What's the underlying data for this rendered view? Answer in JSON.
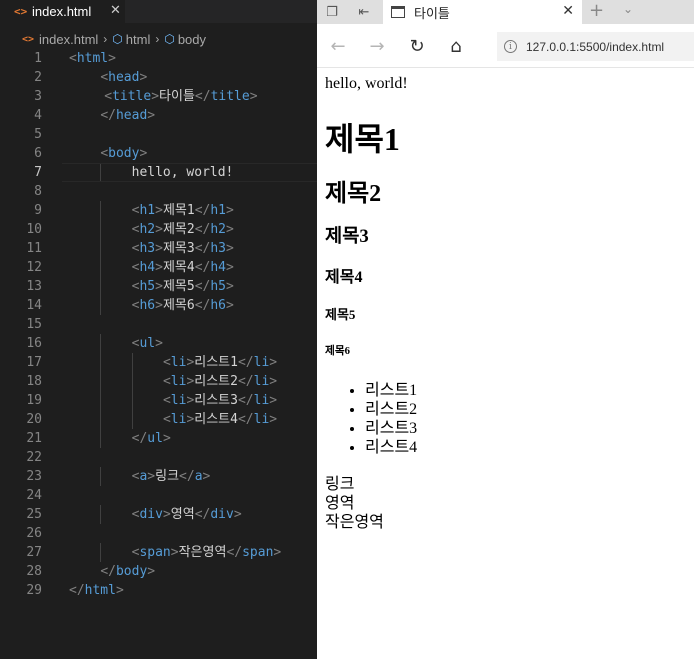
{
  "editor": {
    "tab": {
      "icon": "html-file-icon",
      "title": "index.html",
      "close_glyph": "✕"
    },
    "breadcrumb": [
      "index.html",
      "html",
      "body"
    ],
    "current_line": 7,
    "lines": [
      {
        "n": "1",
        "indent": 0,
        "parts": [
          [
            "t",
            "<"
          ],
          [
            "tn",
            "html"
          ],
          [
            "t",
            ">"
          ]
        ]
      },
      {
        "n": "2",
        "indent": 1,
        "parts": [
          [
            "t",
            "<"
          ],
          [
            "tn",
            "head"
          ],
          [
            "t",
            ">"
          ]
        ]
      },
      {
        "n": "3",
        "indent": 1,
        "extra": "  ",
        "parts": [
          [
            "t",
            "<"
          ],
          [
            "tn",
            "title"
          ],
          [
            "t",
            ">"
          ],
          [
            "tx",
            "타이틀"
          ],
          [
            "t",
            "</"
          ],
          [
            "tn",
            "title"
          ],
          [
            "t",
            ">"
          ]
        ]
      },
      {
        "n": "4",
        "indent": 1,
        "parts": [
          [
            "t",
            "</"
          ],
          [
            "tn",
            "head"
          ],
          [
            "t",
            ">"
          ]
        ]
      },
      {
        "n": "5",
        "indent": 0,
        "parts": []
      },
      {
        "n": "6",
        "indent": 1,
        "parts": [
          [
            "t",
            "<"
          ],
          [
            "tn",
            "body"
          ],
          [
            "t",
            ">"
          ]
        ]
      },
      {
        "n": "7",
        "indent": 2,
        "parts": [
          [
            "tx",
            "hello, world!"
          ]
        ]
      },
      {
        "n": "8",
        "indent": 0,
        "parts": []
      },
      {
        "n": "9",
        "indent": 2,
        "parts": [
          [
            "t",
            "<"
          ],
          [
            "tn",
            "h1"
          ],
          [
            "t",
            ">"
          ],
          [
            "tx",
            "제목1"
          ],
          [
            "t",
            "</"
          ],
          [
            "tn",
            "h1"
          ],
          [
            "t",
            ">"
          ]
        ]
      },
      {
        "n": "10",
        "indent": 2,
        "parts": [
          [
            "t",
            "<"
          ],
          [
            "tn",
            "h2"
          ],
          [
            "t",
            ">"
          ],
          [
            "tx",
            "제목2"
          ],
          [
            "t",
            "</"
          ],
          [
            "tn",
            "h2"
          ],
          [
            "t",
            ">"
          ]
        ]
      },
      {
        "n": "11",
        "indent": 2,
        "parts": [
          [
            "t",
            "<"
          ],
          [
            "tn",
            "h3"
          ],
          [
            "t",
            ">"
          ],
          [
            "tx",
            "제목3"
          ],
          [
            "t",
            "</"
          ],
          [
            "tn",
            "h3"
          ],
          [
            "t",
            ">"
          ]
        ]
      },
      {
        "n": "12",
        "indent": 2,
        "parts": [
          [
            "t",
            "<"
          ],
          [
            "tn",
            "h4"
          ],
          [
            "t",
            ">"
          ],
          [
            "tx",
            "제목4"
          ],
          [
            "t",
            "</"
          ],
          [
            "tn",
            "h4"
          ],
          [
            "t",
            ">"
          ]
        ]
      },
      {
        "n": "13",
        "indent": 2,
        "parts": [
          [
            "t",
            "<"
          ],
          [
            "tn",
            "h5"
          ],
          [
            "t",
            ">"
          ],
          [
            "tx",
            "제목5"
          ],
          [
            "t",
            "</"
          ],
          [
            "tn",
            "h5"
          ],
          [
            "t",
            ">"
          ]
        ]
      },
      {
        "n": "14",
        "indent": 2,
        "parts": [
          [
            "t",
            "<"
          ],
          [
            "tn",
            "h6"
          ],
          [
            "t",
            ">"
          ],
          [
            "tx",
            "제목6"
          ],
          [
            "t",
            "</"
          ],
          [
            "tn",
            "h6"
          ],
          [
            "t",
            ">"
          ]
        ]
      },
      {
        "n": "15",
        "indent": 0,
        "parts": []
      },
      {
        "n": "16",
        "indent": 2,
        "parts": [
          [
            "t",
            "<"
          ],
          [
            "tn",
            "ul"
          ],
          [
            "t",
            ">"
          ]
        ]
      },
      {
        "n": "17",
        "indent": 3,
        "parts": [
          [
            "t",
            "<"
          ],
          [
            "tn",
            "li"
          ],
          [
            "t",
            ">"
          ],
          [
            "tx",
            "리스트1"
          ],
          [
            "t",
            "</"
          ],
          [
            "tn",
            "li"
          ],
          [
            "t",
            ">"
          ]
        ]
      },
      {
        "n": "18",
        "indent": 3,
        "parts": [
          [
            "t",
            "<"
          ],
          [
            "tn",
            "li"
          ],
          [
            "t",
            ">"
          ],
          [
            "tx",
            "리스트2"
          ],
          [
            "t",
            "</"
          ],
          [
            "tn",
            "li"
          ],
          [
            "t",
            ">"
          ]
        ]
      },
      {
        "n": "19",
        "indent": 3,
        "parts": [
          [
            "t",
            "<"
          ],
          [
            "tn",
            "li"
          ],
          [
            "t",
            ">"
          ],
          [
            "tx",
            "리스트3"
          ],
          [
            "t",
            "</"
          ],
          [
            "tn",
            "li"
          ],
          [
            "t",
            ">"
          ]
        ]
      },
      {
        "n": "20",
        "indent": 3,
        "parts": [
          [
            "t",
            "<"
          ],
          [
            "tn",
            "li"
          ],
          [
            "t",
            ">"
          ],
          [
            "tx",
            "리스트4"
          ],
          [
            "t",
            "</"
          ],
          [
            "tn",
            "li"
          ],
          [
            "t",
            ">"
          ]
        ]
      },
      {
        "n": "21",
        "indent": 2,
        "parts": [
          [
            "t",
            "</"
          ],
          [
            "tn",
            "ul"
          ],
          [
            "t",
            ">"
          ]
        ]
      },
      {
        "n": "22",
        "indent": 0,
        "parts": []
      },
      {
        "n": "23",
        "indent": 2,
        "parts": [
          [
            "t",
            "<"
          ],
          [
            "tn",
            "a"
          ],
          [
            "t",
            ">"
          ],
          [
            "tx",
            "링크"
          ],
          [
            "t",
            "</"
          ],
          [
            "tn",
            "a"
          ],
          [
            "t",
            ">"
          ]
        ]
      },
      {
        "n": "24",
        "indent": 0,
        "parts": []
      },
      {
        "n": "25",
        "indent": 2,
        "parts": [
          [
            "t",
            "<"
          ],
          [
            "tn",
            "div"
          ],
          [
            "t",
            ">"
          ],
          [
            "tx",
            "영역"
          ],
          [
            "t",
            "</"
          ],
          [
            "tn",
            "div"
          ],
          [
            "t",
            ">"
          ]
        ]
      },
      {
        "n": "26",
        "indent": 0,
        "parts": []
      },
      {
        "n": "27",
        "indent": 2,
        "parts": [
          [
            "t",
            "<"
          ],
          [
            "tn",
            "span"
          ],
          [
            "t",
            ">"
          ],
          [
            "tx",
            "작은영역"
          ],
          [
            "t",
            "</"
          ],
          [
            "tn",
            "span"
          ],
          [
            "t",
            ">"
          ]
        ]
      },
      {
        "n": "28",
        "indent": 1,
        "parts": [
          [
            "t",
            "</"
          ],
          [
            "tn",
            "body"
          ],
          [
            "t",
            ">"
          ]
        ]
      },
      {
        "n": "29",
        "indent": 0,
        "parts": [
          [
            "t",
            "</"
          ],
          [
            "tn",
            "html"
          ],
          [
            "t",
            ">"
          ]
        ]
      }
    ]
  },
  "browser": {
    "tab": {
      "title": "타이틀",
      "icon": "page-icon",
      "close_glyph": "✕"
    },
    "new_tab_glyph": "+",
    "tab_list_glyph": "⌄",
    "nav": {
      "back_glyph": "←",
      "forward_glyph": "→",
      "refresh_glyph": "↻",
      "home_glyph": "⌂"
    },
    "address": {
      "info_glyph": "i",
      "url": "127.0.0.1:5500/index.html"
    },
    "page": {
      "text": "hello, world!",
      "h1": "제목1",
      "h2": "제목2",
      "h3": "제목3",
      "h4": "제목4",
      "h5": "제목5",
      "h6": "제목6",
      "list": [
        "리스트1",
        "리스트2",
        "리스트3",
        "리스트4"
      ],
      "link": "링크",
      "div": "영역",
      "span": "작은영역"
    }
  }
}
